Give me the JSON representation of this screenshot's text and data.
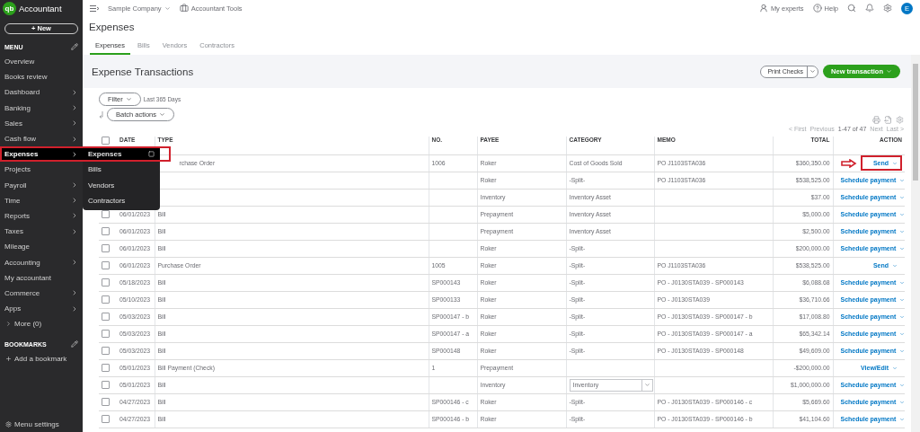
{
  "app": {
    "logo": "qb",
    "name": "Accountant"
  },
  "sidebar": {
    "new_button": "+ New",
    "menu_heading": "MENU",
    "items": [
      {
        "label": "Overview",
        "expandable": false,
        "selected": false,
        "highlighted": false
      },
      {
        "label": "Books review",
        "expandable": false,
        "selected": false,
        "highlighted": false
      },
      {
        "label": "Dashboard",
        "expandable": true,
        "selected": false,
        "highlighted": false
      },
      {
        "label": "Banking",
        "expandable": true,
        "selected": false,
        "highlighted": false
      },
      {
        "label": "Sales",
        "expandable": true,
        "selected": false,
        "highlighted": false
      },
      {
        "label": "Cash flow",
        "expandable": true,
        "selected": false,
        "highlighted": false
      },
      {
        "label": "Expenses",
        "expandable": true,
        "selected": true,
        "highlighted": true
      },
      {
        "label": "Projects",
        "expandable": false,
        "selected": false,
        "highlighted": false
      },
      {
        "label": "Payroll",
        "expandable": true,
        "selected": false,
        "highlighted": false
      },
      {
        "label": "Time",
        "expandable": true,
        "selected": false,
        "highlighted": false
      },
      {
        "label": "Reports",
        "expandable": true,
        "selected": false,
        "highlighted": false
      },
      {
        "label": "Taxes",
        "expandable": true,
        "selected": false,
        "highlighted": false
      },
      {
        "label": "Mileage",
        "expandable": false,
        "selected": false,
        "highlighted": false
      },
      {
        "label": "Accounting",
        "expandable": true,
        "selected": false,
        "highlighted": false
      },
      {
        "label": "My accountant",
        "expandable": false,
        "selected": false,
        "highlighted": false
      },
      {
        "label": "Commerce",
        "expandable": true,
        "selected": false,
        "highlighted": false
      },
      {
        "label": "Apps",
        "expandable": true,
        "selected": false,
        "highlighted": false
      }
    ],
    "more": "More (0)",
    "bookmarks_heading": "BOOKMARKS",
    "add_bookmark": "Add a bookmark",
    "settings": "Menu settings"
  },
  "flyout": {
    "items": [
      {
        "label": "Expenses",
        "selected": true
      },
      {
        "label": "Bills",
        "selected": false
      },
      {
        "label": "Vendors",
        "selected": false
      },
      {
        "label": "Contractors",
        "selected": false
      }
    ]
  },
  "top_bar": {
    "company": "Sample Company",
    "tools": "Accountant Tools",
    "experts": "My experts",
    "help": "Help",
    "avatar": "E"
  },
  "page": {
    "title": "Expenses",
    "tabs": [
      {
        "label": "Expenses",
        "selected": true
      },
      {
        "label": "Bills",
        "selected": false
      },
      {
        "label": "Vendors",
        "selected": false
      },
      {
        "label": "Contractors",
        "selected": false
      }
    ],
    "section_title": "Expense Transactions",
    "print_checks": "Print Checks",
    "new_transaction": "New transaction",
    "filter": "Filter",
    "date_range": "Last 365 Days",
    "batch_actions": "Batch actions",
    "pagination": {
      "first": "< First",
      "previous": "Previous",
      "range": "1-47 of 47",
      "next": "Next",
      "last": "Last >"
    }
  },
  "table": {
    "all_checked": false,
    "columns": [
      "DATE",
      "TYPE",
      "NO.",
      "PAYEE",
      "CATEGORY",
      "MEMO",
      "TOTAL",
      "ACTION"
    ],
    "rows": [
      {
        "type": "rchase Order",
        "no": "1006",
        "payee": "Roker",
        "category": {
          "kind": "text",
          "text": "Cost of Goods Sold"
        },
        "memo": "PO J1103STA036",
        "total": "$360,350.00",
        "action": {
          "label": "Send",
          "highlighted": true
        }
      },
      {
        "payee": "Roker",
        "category": {
          "kind": "text",
          "text": "-Split-"
        },
        "memo": "PO J1103STA036",
        "total": "$538,525.00",
        "action": {
          "label": "Schedule payment",
          "highlighted": false
        }
      },
      {
        "payee": "Inventory",
        "category": {
          "kind": "text",
          "text": "Inventory Asset"
        },
        "total": "$37.00",
        "action": {
          "label": "Schedule payment",
          "highlighted": false
        }
      },
      {
        "checked": false,
        "date": "06/01/2023",
        "type": "Bill",
        "payee": "Prepayment",
        "category": {
          "kind": "text",
          "text": "Inventory Asset"
        },
        "total": "$5,000.00",
        "action": {
          "label": "Schedule payment",
          "highlighted": false
        }
      },
      {
        "checked": false,
        "date": "06/01/2023",
        "type": "Bill",
        "payee": "Prepayment",
        "category": {
          "kind": "text",
          "text": "Inventory Asset"
        },
        "total": "$2,500.00",
        "action": {
          "label": "Schedule payment",
          "highlighted": false
        }
      },
      {
        "checked": false,
        "date": "06/01/2023",
        "type": "Bill",
        "payee": "Roker",
        "category": {
          "kind": "text",
          "text": "-Split-"
        },
        "total": "$200,000.00",
        "action": {
          "label": "Schedule payment",
          "highlighted": false
        }
      },
      {
        "checked": false,
        "date": "06/01/2023",
        "type": "Purchase Order",
        "no": "1005",
        "payee": "Roker",
        "category": {
          "kind": "text",
          "text": "-Split-"
        },
        "memo": "PO J1103STA036",
        "total": "$538,525.00",
        "action": {
          "label": "Send",
          "highlighted": false
        }
      },
      {
        "checked": false,
        "date": "05/18/2023",
        "type": "Bill",
        "no": "SP000143",
        "payee": "Roker",
        "category": {
          "kind": "text",
          "text": "-Split-"
        },
        "memo": "PO - J0130STA039 - SP000143",
        "total": "$6,088.68",
        "action": {
          "label": "Schedule payment",
          "highlighted": false
        }
      },
      {
        "checked": false,
        "date": "05/10/2023",
        "type": "Bill",
        "no": "SP000133",
        "payee": "Roker",
        "category": {
          "kind": "text",
          "text": "-Split-"
        },
        "memo": "PO - J0130STA039",
        "total": "$36,710.66",
        "action": {
          "label": "Schedule payment",
          "highlighted": false
        }
      },
      {
        "checked": false,
        "date": "05/03/2023",
        "type": "Bill",
        "no": "SP000147 - b",
        "payee": "Roker",
        "category": {
          "kind": "text",
          "text": "-Split-"
        },
        "memo": "PO - J0130STA039 - SP000147 - b",
        "total": "$17,008.80",
        "action": {
          "label": "Schedule payment",
          "highlighted": false
        }
      },
      {
        "checked": false,
        "date": "05/03/2023",
        "type": "Bill",
        "no": "SP000147 - a",
        "payee": "Roker",
        "category": {
          "kind": "text",
          "text": "-Split-"
        },
        "memo": "PO - J0130STA039 - SP000147 - a",
        "total": "$65,342.14",
        "action": {
          "label": "Schedule payment",
          "highlighted": false
        }
      },
      {
        "checked": false,
        "date": "05/03/2023",
        "type": "Bill",
        "no": "SP000148",
        "payee": "Roker",
        "category": {
          "kind": "text",
          "text": "-Split-"
        },
        "memo": "PO - J0130STA039 - SP000148",
        "total": "$49,609.00",
        "action": {
          "label": "Schedule payment",
          "highlighted": false
        }
      },
      {
        "checked": false,
        "date": "05/01/2023",
        "type": "Bill Payment (Check)",
        "no": "1",
        "payee": "Prepayment",
        "total": "-$200,000.00",
        "action": {
          "label": "View/Edit",
          "highlighted": false
        }
      },
      {
        "checked": false,
        "date": "05/01/2023",
        "type": "Bill",
        "payee": "Inventory",
        "category": {
          "kind": "select",
          "text": "Inventory"
        },
        "total": "$1,000,000.00",
        "action": {
          "label": "Schedule payment",
          "highlighted": false
        }
      },
      {
        "checked": false,
        "date": "04/27/2023",
        "type": "Bill",
        "no": "SP000146 - c",
        "payee": "Roker",
        "category": {
          "kind": "text",
          "text": "-Split-"
        },
        "memo": "PO - J0130STA039 - SP000146 - c",
        "total": "$5,669.60",
        "action": {
          "label": "Schedule payment",
          "highlighted": false
        }
      },
      {
        "checked": false,
        "date": "04/27/2023",
        "type": "Bill",
        "no": "SP000146 - b",
        "payee": "Roker",
        "category": {
          "kind": "text",
          "text": "-Split-"
        },
        "memo": "PO - J0130STA039 - SP000146 - b",
        "total": "$41,104.60",
        "action": {
          "label": "Schedule payment",
          "highlighted": false
        }
      }
    ]
  }
}
